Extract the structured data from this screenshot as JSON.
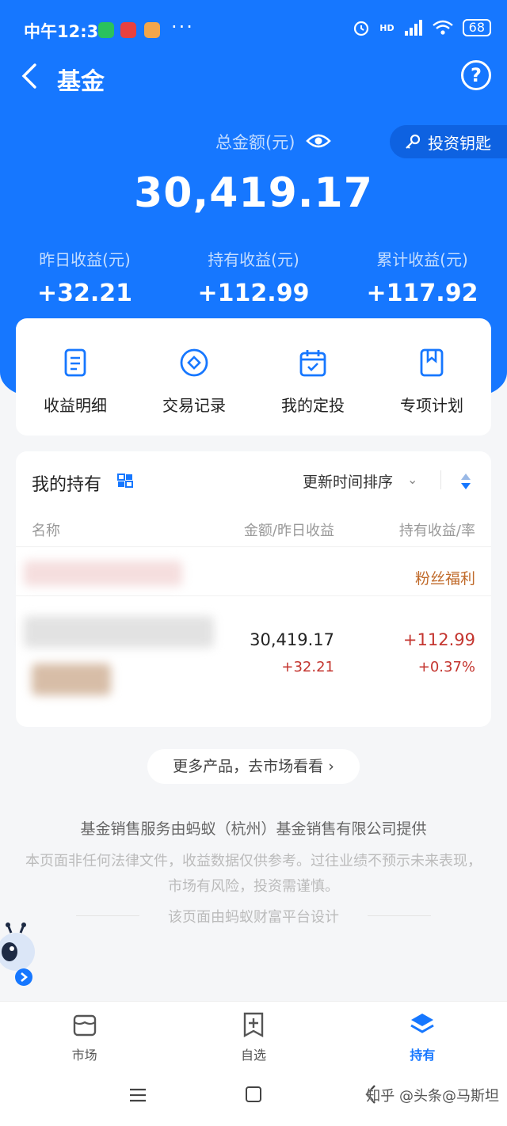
{
  "status": {
    "time": "中午12:31",
    "dots": "···",
    "hd": "HD",
    "battery": "68"
  },
  "header": {
    "title": "基金"
  },
  "summary": {
    "total_label": "总金额(元)",
    "total_amount": "30,419.17",
    "key_label": "投资钥匙",
    "stats": [
      {
        "label": "昨日收益(元)",
        "value": "+32.21"
      },
      {
        "label": "持有收益(元)",
        "value": "+112.99"
      },
      {
        "label": "累计收益(元)",
        "value": "+117.92"
      }
    ]
  },
  "quick_actions": [
    {
      "label": "收益明细",
      "icon": "document-icon"
    },
    {
      "label": "交易记录",
      "icon": "diamond-circle-icon"
    },
    {
      "label": "我的定投",
      "icon": "calendar-check-icon"
    },
    {
      "label": "专项计划",
      "icon": "bookmark-icon"
    }
  ],
  "holdings": {
    "title": "我的持有",
    "sort_label": "更新时间排序",
    "columns": {
      "name": "名称",
      "amount": "金额/昨日收益",
      "profit": "持有收益/率"
    },
    "fan_tag": "粉丝福利",
    "fund": {
      "amount": "30,419.17",
      "yesterday": "+32.21",
      "hold_profit": "+112.99",
      "hold_rate": "+0.37%"
    }
  },
  "more_button": "更多产品，去市场看看",
  "footer": {
    "provider": "基金销售服务由蚂蚁（杭州）基金销售有限公司提供",
    "disclaimer": "本页面非任何法律文件，收益数据仅供参考。过往业绩不预示未来表现，市场有风险，投资需谨慎。",
    "design": "该页面由蚂蚁财富平台设计"
  },
  "tabs": [
    {
      "label": "市场",
      "icon": "market-icon",
      "active": false
    },
    {
      "label": "自选",
      "icon": "add-bookmark-icon",
      "active": false
    },
    {
      "label": "持有",
      "icon": "layers-icon",
      "active": true
    }
  ],
  "watermark": "知乎 @头条@马斯坦",
  "colors": {
    "brand": "#1677ff",
    "profit_red": "#c4352f",
    "tag_orange": "#c06a2a"
  }
}
